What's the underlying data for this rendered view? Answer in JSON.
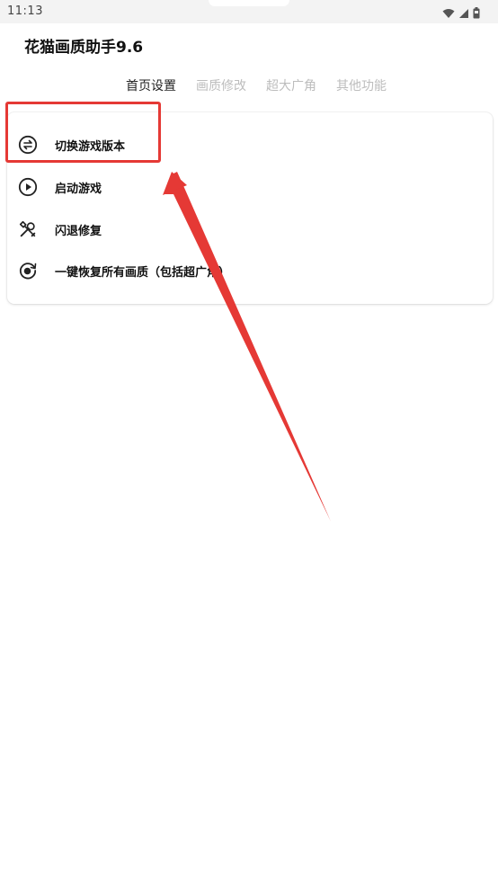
{
  "status_bar": {
    "time": "11:13",
    "icons": [
      "wifi-icon",
      "signal-icon",
      "battery-icon"
    ]
  },
  "app": {
    "title": "花猫画质助手9.6"
  },
  "tabs": [
    {
      "label": "首页设置",
      "active": true
    },
    {
      "label": "画质修改",
      "active": false
    },
    {
      "label": "超大广角",
      "active": false
    },
    {
      "label": "其他功能",
      "active": false
    }
  ],
  "menu": {
    "items": [
      {
        "label": "切换游戏版本",
        "icon": "switch-arrows-icon"
      },
      {
        "label": "启动游戏",
        "icon": "play-icon"
      },
      {
        "label": "闪退修复",
        "icon": "wrench-screwdriver-icon"
      },
      {
        "label": "一键恢复所有画质（包括超广角）",
        "icon": "restore-icon"
      }
    ]
  },
  "annotation": {
    "color": "#e53935",
    "target": "切换游戏版本"
  }
}
